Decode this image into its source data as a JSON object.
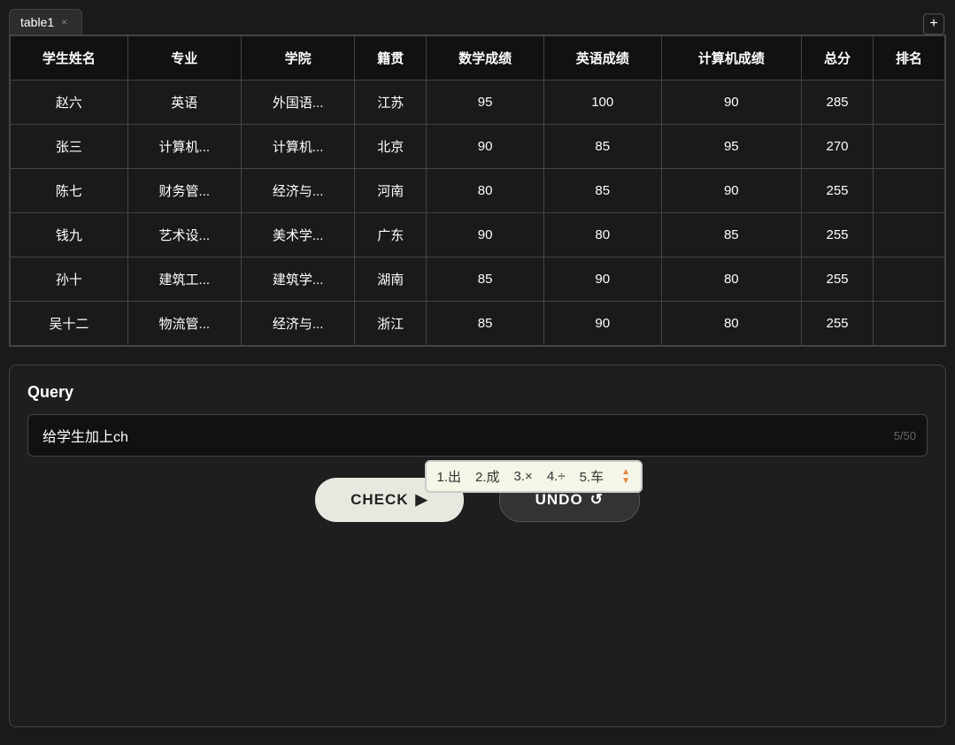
{
  "tab": {
    "label": "table1",
    "close_icon": "×",
    "add_icon": "+"
  },
  "table": {
    "headers": [
      "学生姓名",
      "专业",
      "学院",
      "籍贯",
      "数学成绩",
      "英语成绩",
      "计算机成绩",
      "总分",
      "排名"
    ],
    "rows": [
      [
        "赵六",
        "英语",
        "外国语...",
        "江苏",
        "95",
        "100",
        "90",
        "285",
        ""
      ],
      [
        "张三",
        "计算机...",
        "计算机...",
        "北京",
        "90",
        "85",
        "95",
        "270",
        ""
      ],
      [
        "陈七",
        "财务管...",
        "经济与...",
        "河南",
        "80",
        "85",
        "90",
        "255",
        ""
      ],
      [
        "钱九",
        "艺术设...",
        "美术学...",
        "广东",
        "90",
        "80",
        "85",
        "255",
        ""
      ],
      [
        "孙十",
        "建筑工...",
        "建筑学...",
        "湖南",
        "85",
        "90",
        "80",
        "255",
        ""
      ],
      [
        "吴十二",
        "物流管...",
        "经济与...",
        "浙江",
        "85",
        "90",
        "80",
        "255",
        ""
      ]
    ]
  },
  "query": {
    "label": "Query",
    "input_value": "给学生加上ch",
    "char_count": "5/50",
    "autocomplete_options": [
      "1.出",
      "2.成",
      "3.×",
      "4.÷",
      "5.车"
    ]
  },
  "buttons": {
    "check_label": "CHECK",
    "check_icon": "▶",
    "undo_label": "UNDO",
    "undo_icon": "↺"
  }
}
